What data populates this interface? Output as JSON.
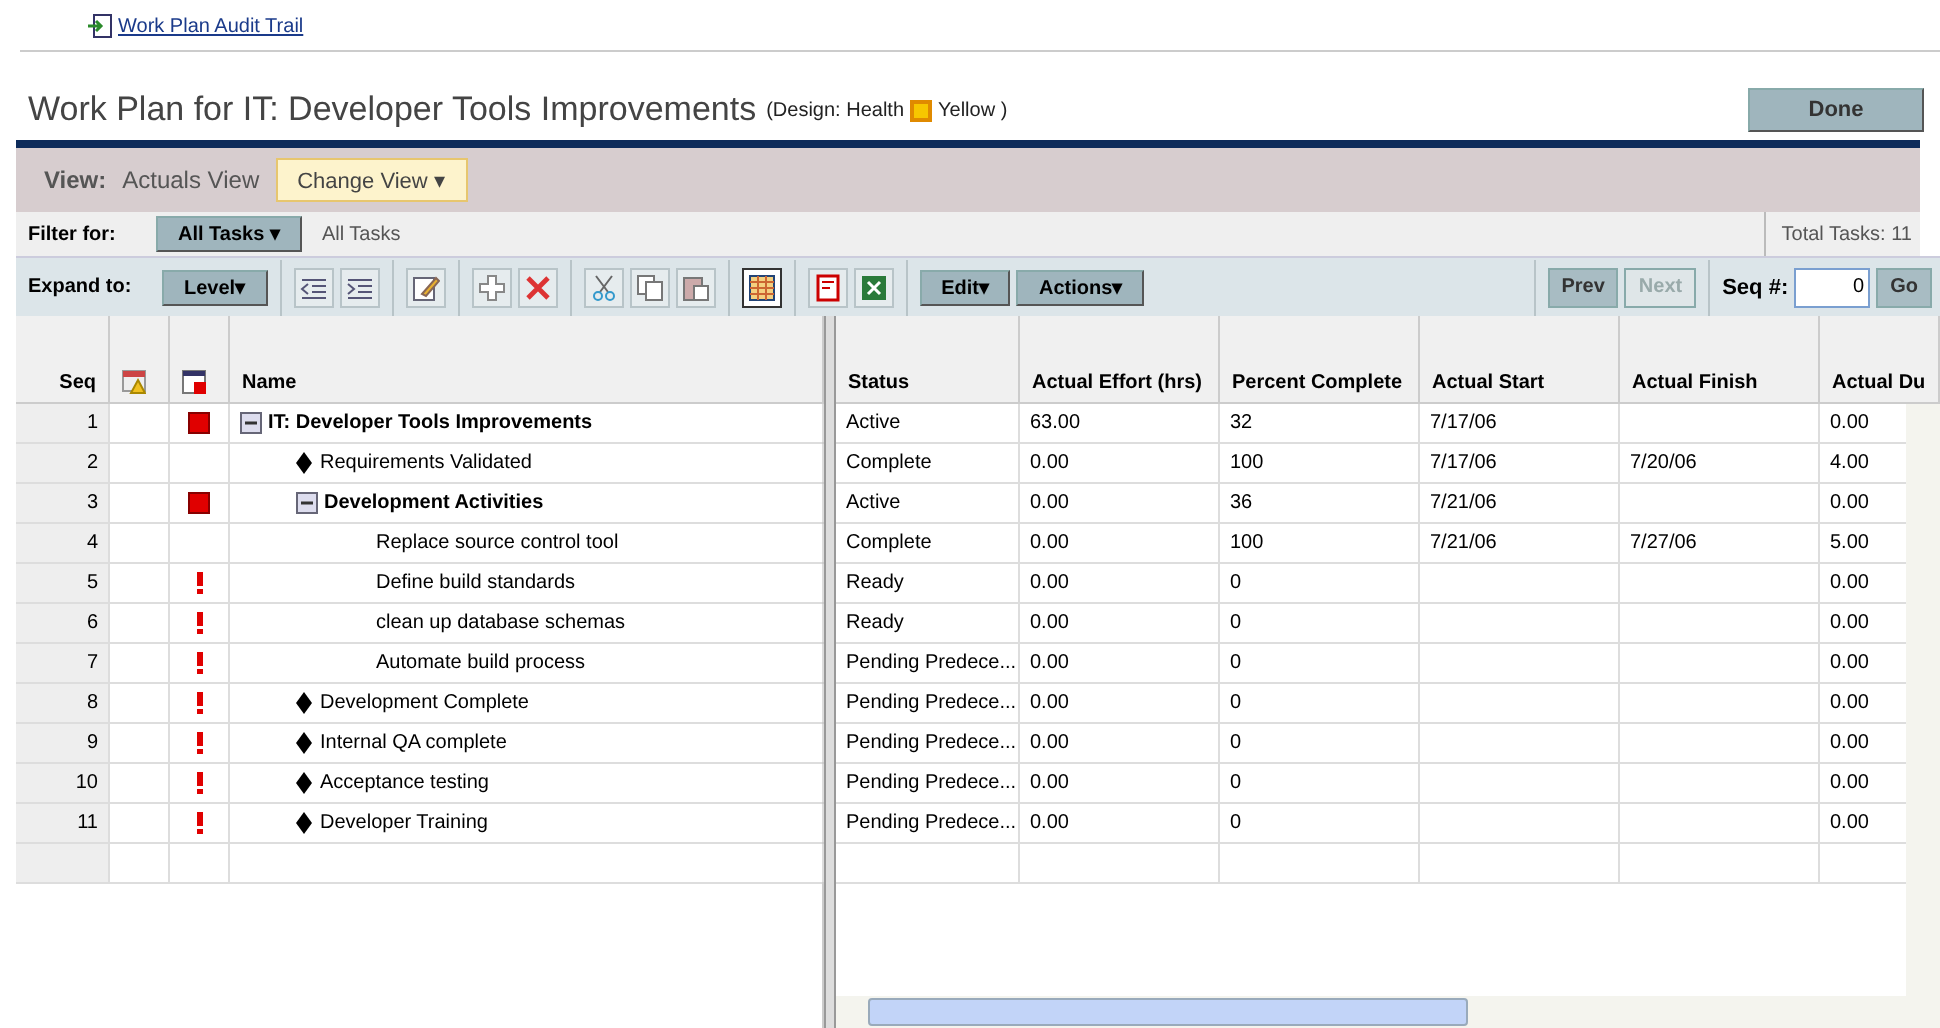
{
  "audit_link": "Work Plan Audit Trail",
  "title": {
    "main": "Work Plan for IT: Developer Tools Improvements",
    "design": "(Design: Health",
    "health": "Yellow )"
  },
  "done_button": "Done",
  "view_bar": {
    "label": "View:",
    "value": "Actuals View",
    "change_button": "Change View ▾"
  },
  "filter_bar": {
    "label": "Filter for:",
    "dropdown": "All Tasks ▾",
    "value": "All Tasks",
    "total": "Total Tasks: 11"
  },
  "toolbar": {
    "label": "Expand to:",
    "level_button": "Level▾",
    "tools": [
      {
        "kind": "outdent",
        "selected": false
      },
      {
        "kind": "indent",
        "selected": false
      },
      {
        "kind": "edit",
        "selected": false
      },
      {
        "kind": "add",
        "selected": false
      },
      {
        "kind": "delete",
        "selected": false
      },
      {
        "kind": "cut",
        "selected": false
      },
      {
        "kind": "copy",
        "selected": false
      },
      {
        "kind": "paste",
        "selected": false
      },
      {
        "kind": "grid",
        "selected": true
      },
      {
        "kind": "pdf",
        "selected": false
      },
      {
        "kind": "excel",
        "selected": false
      }
    ],
    "edit_button": "Edit▾",
    "actions_button": "Actions▾",
    "prev_button": {
      "label": "Prev",
      "disabled": false
    },
    "next_button": {
      "label": "Next",
      "disabled": true
    },
    "seq_label": "Seq #:",
    "seq_value": "0",
    "go_button": "Go"
  },
  "left_columns": [
    "Seq",
    "Name"
  ],
  "right_columns": [
    "Status",
    "Actual Effort (hrs)",
    "Percent Complete",
    "Actual Start",
    "Actual Finish",
    "Actual Du"
  ],
  "tasks": [
    {
      "seq": "1",
      "flagged": true,
      "warning": false,
      "kind": "summary",
      "expanded": true,
      "name": "IT: Developer Tools Improvements",
      "cells": [
        "Active",
        "63.00",
        "32",
        "7/17/06",
        "",
        "0.00"
      ],
      "children": [
        {
          "seq": "2",
          "flagged": false,
          "warning": false,
          "kind": "milestone",
          "name": "Requirements Validated",
          "cells": [
            "Complete",
            "0.00",
            "100",
            "7/17/06",
            "7/20/06",
            "4.00"
          ]
        },
        {
          "seq": "3",
          "flagged": true,
          "warning": false,
          "kind": "summary",
          "expanded": true,
          "name": "Development Activities",
          "cells": [
            "Active",
            "0.00",
            "36",
            "7/21/06",
            "",
            "0.00"
          ],
          "children": [
            {
              "seq": "4",
              "flagged": false,
              "warning": false,
              "kind": "task",
              "name": "Replace source control tool",
              "cells": [
                "Complete",
                "0.00",
                "100",
                "7/21/06",
                "7/27/06",
                "5.00"
              ]
            },
            {
              "seq": "5",
              "flagged": false,
              "warning": true,
              "kind": "task",
              "name": "Define build standards",
              "cells": [
                "Ready",
                "0.00",
                "0",
                "",
                "",
                "0.00"
              ]
            },
            {
              "seq": "6",
              "flagged": false,
              "warning": true,
              "kind": "task",
              "name": "clean up database schemas",
              "cells": [
                "Ready",
                "0.00",
                "0",
                "",
                "",
                "0.00"
              ]
            },
            {
              "seq": "7",
              "flagged": false,
              "warning": true,
              "kind": "task",
              "name": "Automate build process",
              "cells": [
                "Pending Predece...",
                "0.00",
                "0",
                "",
                "",
                "0.00"
              ]
            }
          ]
        },
        {
          "seq": "8",
          "flagged": false,
          "warning": true,
          "kind": "milestone",
          "name": "Development Complete",
          "cells": [
            "Pending Predece...",
            "0.00",
            "0",
            "",
            "",
            "0.00"
          ]
        },
        {
          "seq": "9",
          "flagged": false,
          "warning": true,
          "kind": "milestone",
          "name": "Internal QA complete",
          "cells": [
            "Pending Predece...",
            "0.00",
            "0",
            "",
            "",
            "0.00"
          ]
        },
        {
          "seq": "10",
          "flagged": false,
          "warning": true,
          "kind": "milestone",
          "name": "Acceptance testing",
          "cells": [
            "Pending Predece...",
            "0.00",
            "0",
            "",
            "",
            "0.00"
          ]
        },
        {
          "seq": "11",
          "flagged": false,
          "warning": true,
          "kind": "milestone",
          "name": "Developer Training",
          "cells": [
            "Pending Predece...",
            "0.00",
            "0",
            "",
            "",
            "0.00"
          ]
        }
      ]
    }
  ]
}
